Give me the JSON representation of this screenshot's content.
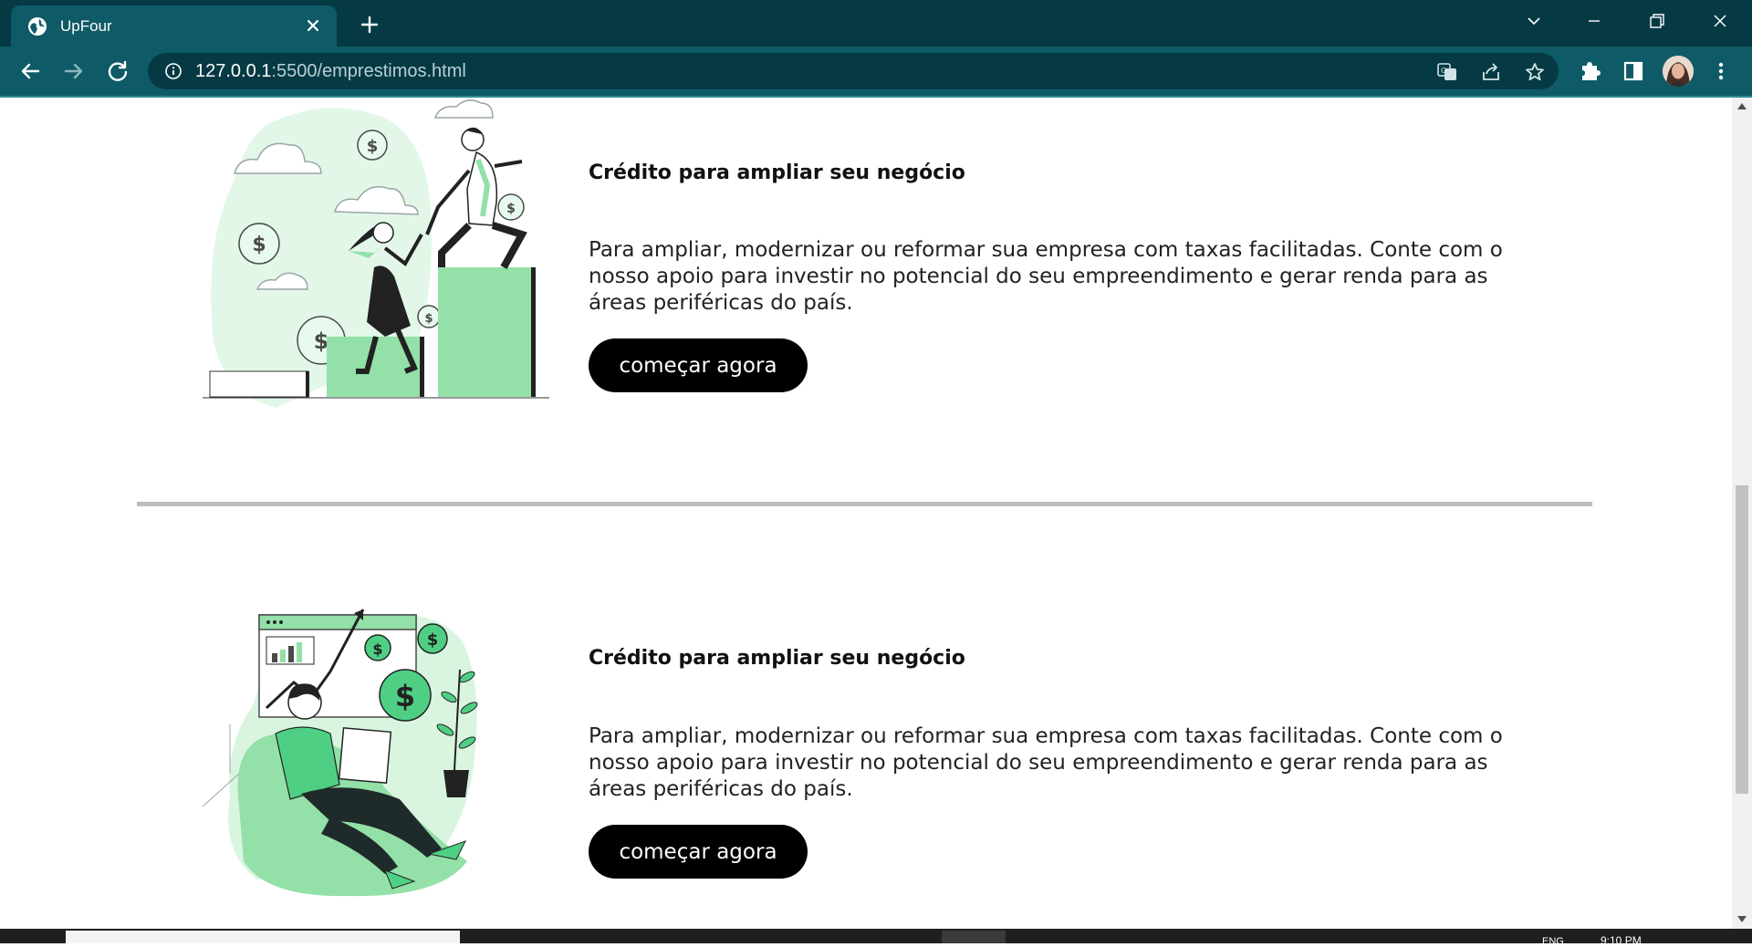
{
  "browser": {
    "tab_title": "UpFour",
    "url_host": "127.0.0.1",
    "url_rest": ":5500/emprestimos.html",
    "theme_color": "#0e5b67"
  },
  "cards": [
    {
      "title": "Crédito para ampliar seu negócio",
      "text": "Para ampliar, modernizar ou reformar sua empresa com taxas facilitadas. Conte com o nosso apoio para investir no potencial do seu empreendimento e gerar renda para as áreas periféricas do país.",
      "button_label": "começar agora"
    },
    {
      "title": "Crédito para ampliar seu negócio",
      "text": "Para ampliar, modernizar ou reformar sua empresa com taxas facilitadas. Conte com o nosso apoio para investir no potencial do seu empreendimento e gerar renda para as áreas periféricas do país.",
      "button_label": "começar agora"
    }
  ],
  "taskbar": {
    "language": "ENG",
    "time": "9:10 PM"
  },
  "colors": {
    "accent_green": "#93e0a8",
    "light_green": "#d9f5e0",
    "button_bg": "#000000",
    "divider": "#bdbdbd"
  }
}
